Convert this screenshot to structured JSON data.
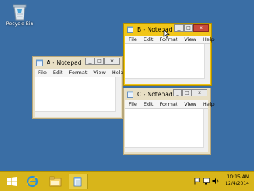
{
  "desktop": {
    "recycle_bin_label": "Recycle Bin",
    "background_color": "#3a6ea5"
  },
  "windows": [
    {
      "id": "a",
      "title": "A - Notepad",
      "state": "inactive",
      "menu": [
        "File",
        "Edit",
        "Format",
        "View",
        "Help"
      ],
      "content": ""
    },
    {
      "id": "b",
      "title": "B - Notepad",
      "state": "active",
      "menu": [
        "File",
        "Edit",
        "Format",
        "View",
        "Help"
      ],
      "content": ""
    },
    {
      "id": "c",
      "title": "C - Notepad",
      "state": "inactive",
      "menu": [
        "File",
        "Edit",
        "Format",
        "View",
        "Help"
      ],
      "content": ""
    }
  ],
  "window_buttons": {
    "minimize": "_",
    "maximize": "□",
    "close": "x"
  },
  "taskbar": {
    "color": "#d8b51a",
    "items": [
      "start-icon",
      "internet-explorer-icon",
      "file-explorer-icon",
      "notepad-icon"
    ],
    "clock": {
      "time": "10:15 AM",
      "date": "12/4/2014"
    },
    "tray_icons": [
      "flag-icon",
      "network-icon",
      "volume-icon"
    ]
  },
  "colors": {
    "active_frame": "#f2c618",
    "inactive_frame": "#e8dfc4",
    "close_button_active": "#c94a3b"
  }
}
